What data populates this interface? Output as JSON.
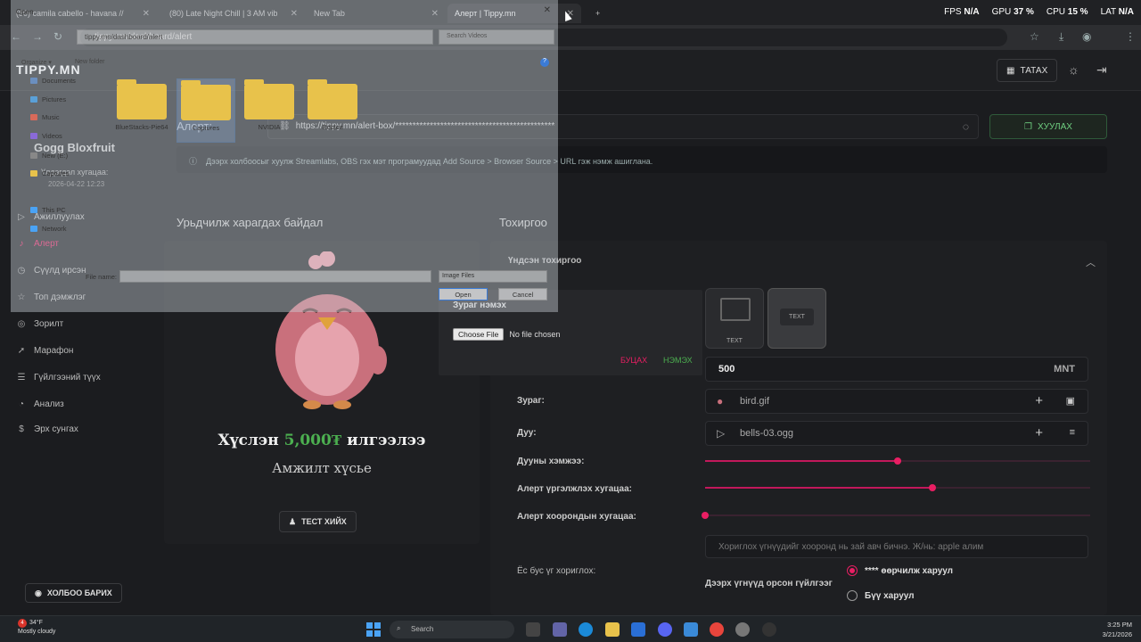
{
  "browser": {
    "tabs": [
      {
        "label": "(80) camila cabello - havana //"
      },
      {
        "label": "(80) Late Night Chill | 3 AM vib"
      },
      {
        "label": "New Tab"
      },
      {
        "label": "Алерт | Tippy.mn"
      }
    ],
    "url": "tippy.mn/dashboard/alert",
    "perf": {
      "fps_label": "FPS",
      "fps": "N/A",
      "gpu_label": "GPU",
      "gpu": "37 %",
      "cpu_label": "CPU",
      "cpu": "15 %",
      "lat_label": "LAT",
      "lat": "N/A"
    }
  },
  "app": {
    "logo": "TIPPY.MN",
    "download_label": "ТАТАХ",
    "sidebar": {
      "user": "Gogg Bloxfruit",
      "remaining_label": "Үлдэгдэл хугацаа:",
      "remaining_value": "2026-04-22 12:23",
      "items": [
        {
          "label": "Ажиллуулах"
        },
        {
          "label": "Алерт"
        },
        {
          "label": "Сүүлд ирсэн"
        },
        {
          "label": "Топ дэмжлэг"
        },
        {
          "label": "Зорилт"
        },
        {
          "label": "Марафон"
        },
        {
          "label": "Гүйлгээний түүх"
        },
        {
          "label": "Анализ"
        },
        {
          "label": "Эрх сунгах"
        }
      ],
      "help_label": "ХОЛБОО БАРИХ"
    },
    "alert_title": "Алерт:",
    "alert_link": "https://tippy.mn/alert-box/**********************************************",
    "copy_label": "ХУУЛАХ",
    "info_text": "Дээрх холбоосыг хуулж Streamlabs, OBS гэх мэт програмуудад Add Source > Browser Source > URL гэж нэмж ашиглана.",
    "preview_title": "Урьдчилж харагдах байдал",
    "settings_title": "Тохиргоо",
    "preview": {
      "message_prefix": "Хүслэн",
      "message_amount": "5,000₮",
      "message_suffix": "илгээлээ",
      "sub": "Амжилт хүсье",
      "test_label": "ТЕСТ ХИЙХ"
    },
    "settings": {
      "basic_label": "Үндсэн тохиргоо",
      "thumb_img_label": "TEXT",
      "thumb_text_label": "TEXT",
      "amount": "500",
      "currency": "MNT",
      "image_label": "Зураг:",
      "image_file": "bird.gif",
      "sound_label": "Дуу:",
      "sound_file": "bells-03.ogg",
      "volume_label": "Дууны хэмжээ:",
      "volume": 0.5,
      "duration_label": "Алерт үргэлжлэх хугацаа:",
      "duration": 0.59,
      "interval_label": "Алерт хоорондын хугацаа:",
      "interval": 0.0,
      "filter_placeholder": "Хориглох үгнүүдийг хооронд нь зай авч бичнэ. Ж/нь: apple алим",
      "filter_label": "Ёс бус үг хориглох:",
      "contains_label": "Дээрх үгнүүд орсон гүйлгээг",
      "radio_options": [
        {
          "label": "**** өөрчилж харуул",
          "selected": true
        },
        {
          "label": "Бүү харуул",
          "selected": false
        }
      ]
    },
    "popup": {
      "title": "Зураг нэмэх",
      "choose_label": "Choose File",
      "no_file": "No file chosen",
      "cancel_label": "БУЦАХ",
      "add_label": "НЭМЭХ"
    }
  },
  "file_dialog": {
    "title": "Open",
    "path": "tippy.mn/dashboard/alert",
    "search_placeholder": "Search Videos",
    "organize_label": "Organize ▾",
    "new_folder_label": "New folder",
    "nav": [
      {
        "label": "Documents"
      },
      {
        "label": "Pictures"
      },
      {
        "label": "Music"
      },
      {
        "label": "Videos"
      },
      {
        "label": "New (E:)"
      },
      {
        "label": "Captures"
      },
      {
        "label": "This PC"
      },
      {
        "label": "Network"
      }
    ],
    "folders": [
      {
        "label": "BlueStacks-Pie64"
      },
      {
        "label": "Captures"
      },
      {
        "label": "NVIDIA"
      },
      {
        "label": "Roblox"
      }
    ],
    "file_name_label": "File name:",
    "file_type": "Image Files",
    "open_label": "Open",
    "cancel_label": "Cancel"
  },
  "taskbar": {
    "temp": "34°F",
    "weather": "Mostly cloudy",
    "badge": "4",
    "search_label": "Search",
    "time": "3:25 PM",
    "date": "3/21/2026"
  }
}
